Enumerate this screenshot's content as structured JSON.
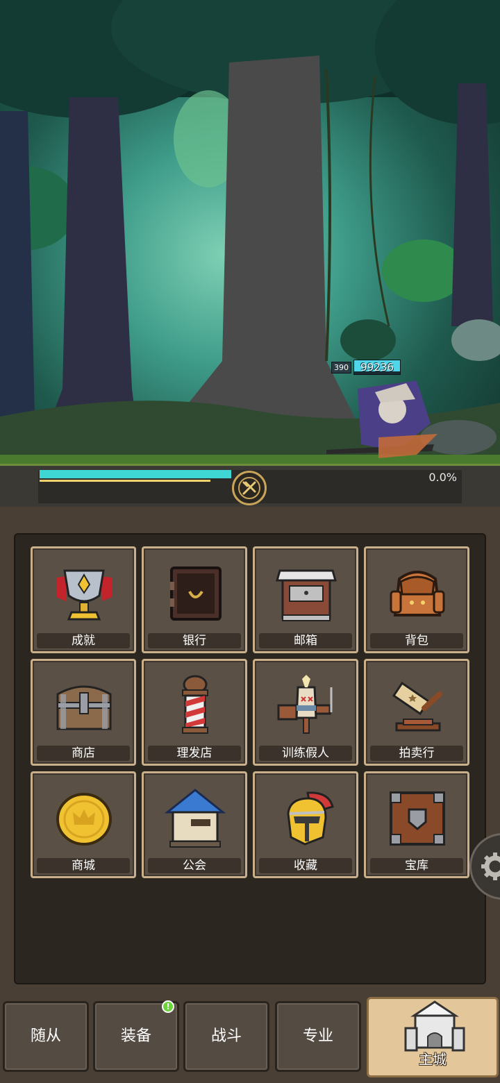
{
  "battle": {
    "enemy_level": "390",
    "enemy_hp": "99236",
    "enemy_hp_fraction": 1.0,
    "stage_progress_fraction": 0.46,
    "secondary_progress_fraction": 0.41,
    "progress_percent": "0.0%"
  },
  "menu": {
    "tiles": [
      {
        "label": "成就",
        "icon": "trophy-icon"
      },
      {
        "label": "银行",
        "icon": "safe-icon"
      },
      {
        "label": "邮箱",
        "icon": "mailbox-icon"
      },
      {
        "label": "背包",
        "icon": "backpack-icon"
      },
      {
        "label": "商店",
        "icon": "chest-icon"
      },
      {
        "label": "理发店",
        "icon": "barber-pole-icon"
      },
      {
        "label": "训练假人",
        "icon": "training-dummy-icon"
      },
      {
        "label": "拍卖行",
        "icon": "gavel-icon"
      },
      {
        "label": "商城",
        "icon": "gold-coin-icon"
      },
      {
        "label": "公会",
        "icon": "guild-house-icon"
      },
      {
        "label": "收藏",
        "icon": "helmet-icon"
      },
      {
        "label": "宝库",
        "icon": "vault-crate-icon"
      }
    ]
  },
  "nav": {
    "items": [
      {
        "label": "随从"
      },
      {
        "label": "装备",
        "badge": "!"
      },
      {
        "label": "战斗"
      },
      {
        "label": "专业"
      }
    ],
    "active": {
      "label": "主城",
      "icon": "castle-icon"
    }
  },
  "colors": {
    "progress_cyan": "#3fd7d4",
    "progress_yellow": "#f2d36b",
    "tile_border": "#c9b08a",
    "badge_green": "#6bd43a"
  }
}
